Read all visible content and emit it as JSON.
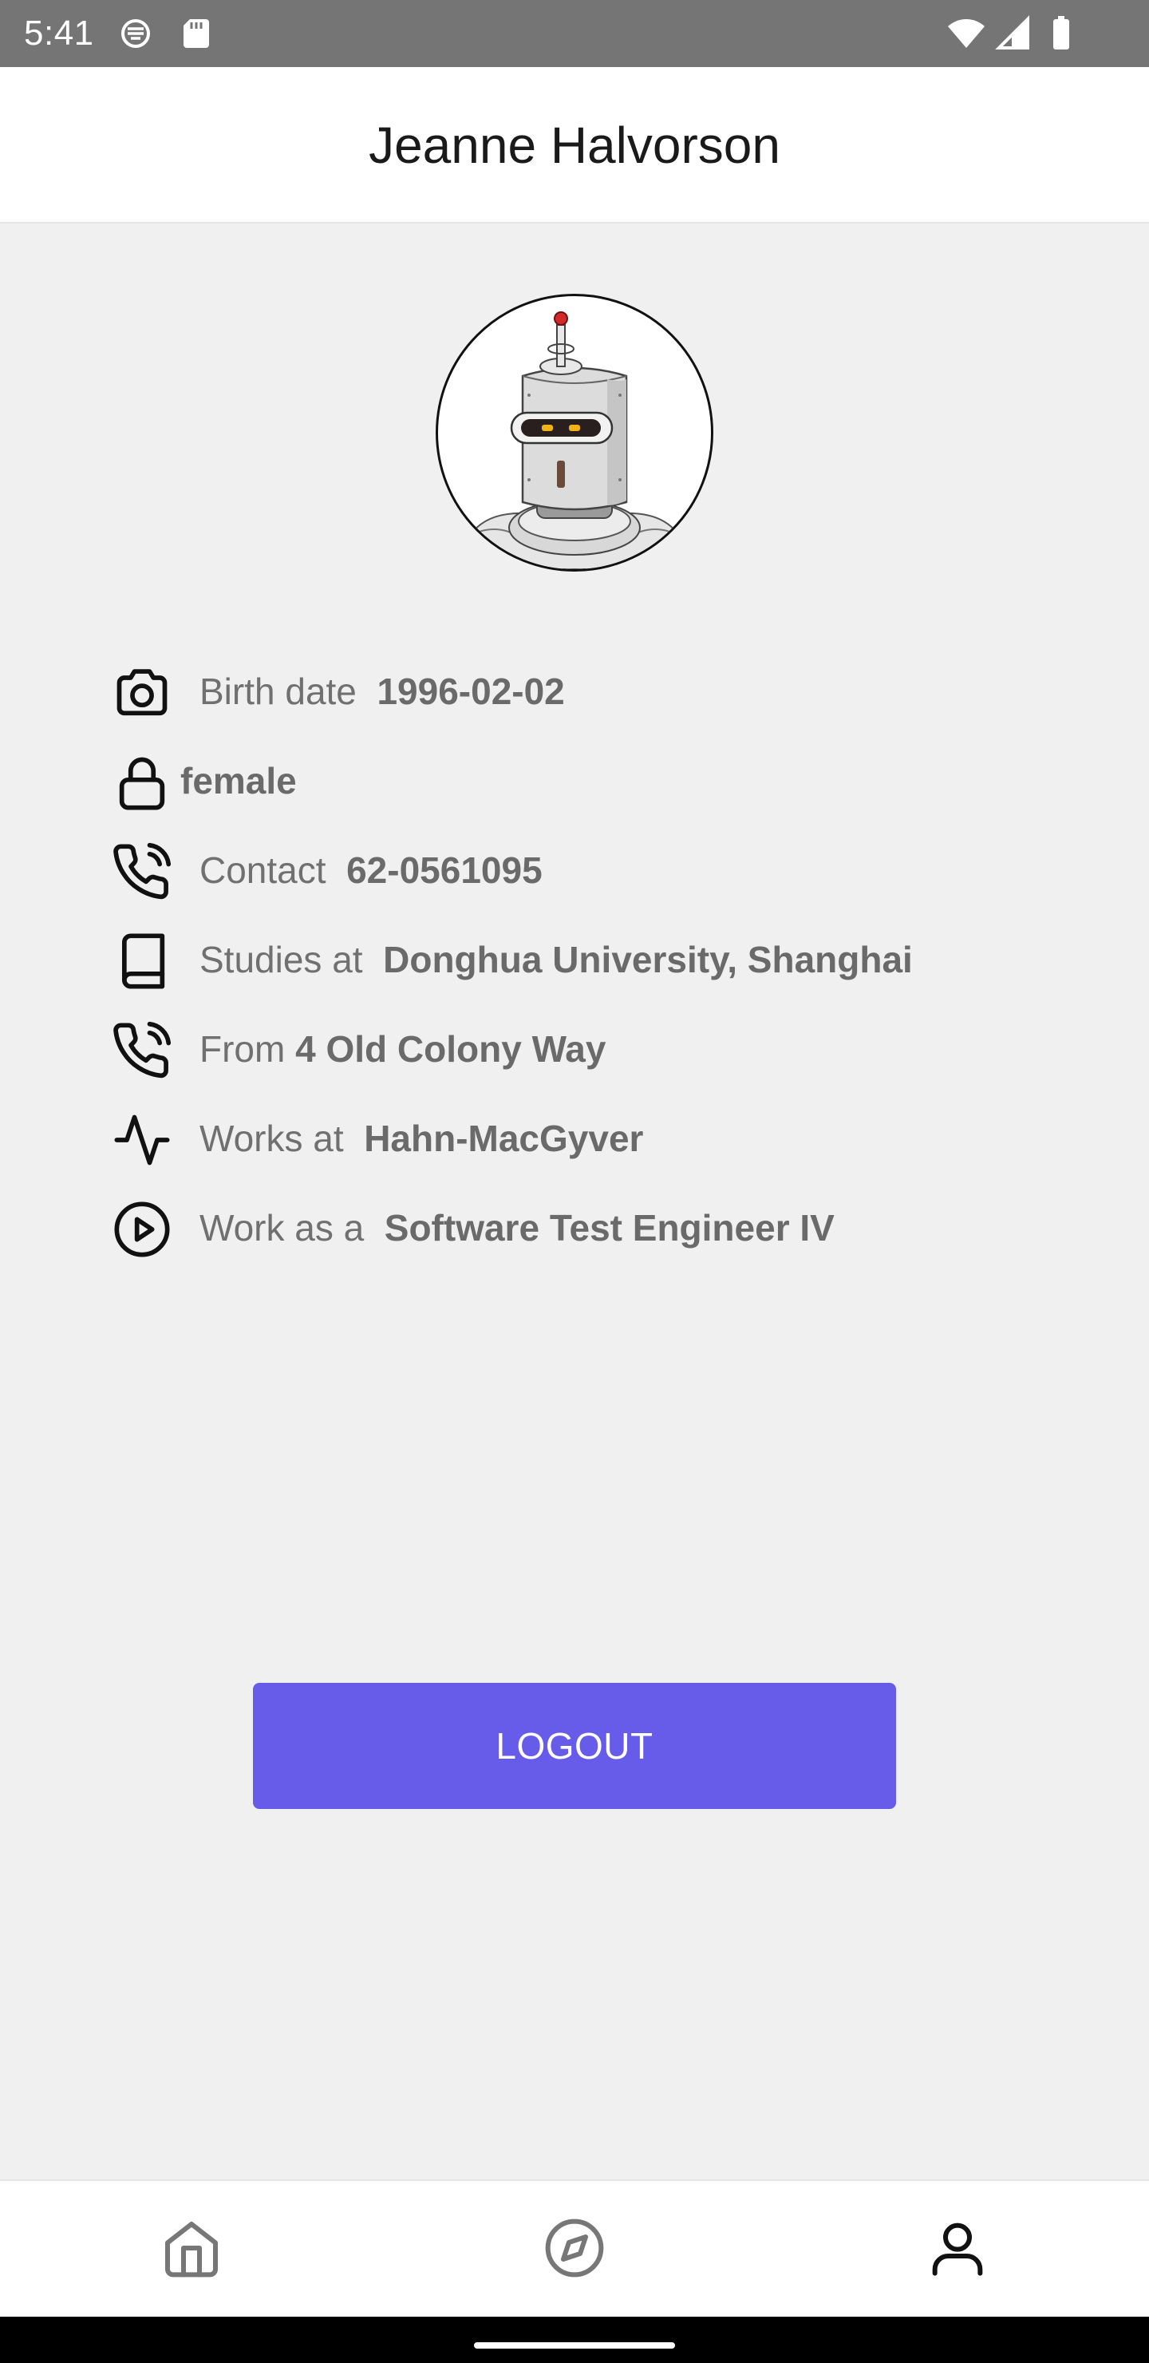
{
  "status_bar": {
    "time": "5:41",
    "icons": [
      "sim-shield-icon",
      "sd-card-icon",
      "wifi-icon",
      "cell-signal-icon",
      "battery-icon"
    ]
  },
  "header": {
    "title": "Jeanne Halvorson"
  },
  "avatar": {
    "description_icon": "robot-avatar-icon"
  },
  "info": {
    "birth": {
      "icon": "camera-icon",
      "label": "Birth date",
      "value": "1996-02-02"
    },
    "gender": {
      "icon": "lock-icon",
      "value": "female"
    },
    "contact": {
      "icon": "phone-call-icon",
      "label": "Contact",
      "value": "62-0561095"
    },
    "studies": {
      "icon": "book-icon",
      "label": "Studies at",
      "value": "Donghua University, Shanghai"
    },
    "from": {
      "icon": "phone-call-icon",
      "label": "From",
      "value": "4 Old Colony Way"
    },
    "works_at": {
      "icon": "activity-icon",
      "label": "Works at",
      "value": "Hahn-MacGyver"
    },
    "work_as": {
      "icon": "play-circle-icon",
      "label": "Work as a",
      "value": "Software Test Engineer IV"
    }
  },
  "logout_label": "LOGOUT",
  "bottom_nav": {
    "items": [
      {
        "icon": "home-icon",
        "active": false
      },
      {
        "icon": "compass-icon",
        "active": false
      },
      {
        "icon": "user-icon",
        "active": true
      }
    ]
  },
  "colors": {
    "accent": "#675bea",
    "status_bar": "#757575",
    "background": "#f0f0f1"
  }
}
